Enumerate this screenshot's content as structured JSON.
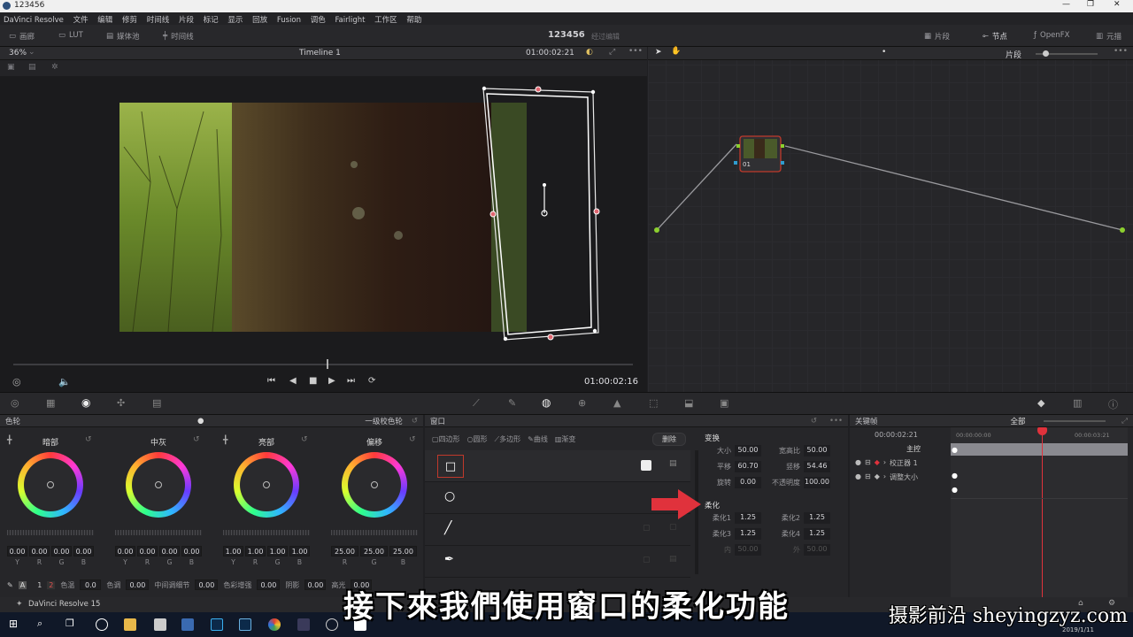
{
  "window": {
    "title": "123456"
  },
  "menu": [
    "DaVinci Resolve",
    "文件",
    "编辑",
    "修剪",
    "时间线",
    "片段",
    "标记",
    "显示",
    "回放",
    "Fusion",
    "调色",
    "Fairlight",
    "工作区",
    "帮助"
  ],
  "toolbar": {
    "left": [
      "画廊",
      "LUT",
      "媒体池",
      "时间线"
    ],
    "project": "123456",
    "status": "经过编辑",
    "right": [
      "片段",
      "节点",
      "OpenFX",
      "元描"
    ]
  },
  "viewer": {
    "zoom": "36%",
    "timeline": "Timeline 1",
    "timecode_top": "01:00:02:21",
    "timecode_bottom": "01:00:02:16"
  },
  "nodes": {
    "clip_dropdown": "片段",
    "node_label": "01"
  },
  "color_wheels": {
    "title": "色轮",
    "mode": "一级校色轮",
    "wheels": [
      {
        "name": "暗部",
        "values": [
          "0.00",
          "0.00",
          "0.00",
          "0.00"
        ],
        "channels": [
          "Y",
          "R",
          "G",
          "B"
        ]
      },
      {
        "name": "中灰",
        "values": [
          "0.00",
          "0.00",
          "0.00",
          "0.00"
        ],
        "channels": [
          "Y",
          "R",
          "G",
          "B"
        ]
      },
      {
        "name": "亮部",
        "values": [
          "1.00",
          "1.00",
          "1.00",
          "1.00"
        ],
        "channels": [
          "Y",
          "R",
          "G",
          "B"
        ]
      },
      {
        "name": "偏移",
        "values": [
          "25.00",
          "25.00",
          "25.00"
        ],
        "channels": [
          "R",
          "G",
          "B"
        ]
      }
    ],
    "bottom": {
      "page1": "1",
      "page2": "2",
      "items": [
        {
          "label": "色温",
          "value": "0.0"
        },
        {
          "label": "色调",
          "value": "0.00"
        },
        {
          "label": "中间调细节",
          "value": "0.00"
        },
        {
          "label": "色彩增强",
          "value": "0.00"
        },
        {
          "label": "阴影",
          "value": "0.00"
        },
        {
          "label": "高光",
          "value": "0.00"
        }
      ]
    }
  },
  "window_panel": {
    "title": "窗口",
    "tools": [
      "四边形",
      "圆形",
      "多边形",
      "曲线",
      "渐变"
    ],
    "delete": "删除",
    "transform": {
      "title": "变换",
      "fields": [
        {
          "label": "大小",
          "value": "50.00"
        },
        {
          "label": "宽高比",
          "value": "50.00"
        },
        {
          "label": "平移",
          "value": "60.70"
        },
        {
          "label": "竖移",
          "value": "54.46"
        },
        {
          "label": "旋转",
          "value": "0.00"
        },
        {
          "label": "不透明度",
          "value": "100.00"
        }
      ]
    },
    "softness": {
      "title": "柔化",
      "fields": [
        {
          "label": "柔化1",
          "value": "1.25"
        },
        {
          "label": "柔化2",
          "value": "1.25"
        },
        {
          "label": "柔化3",
          "value": "1.25"
        },
        {
          "label": "柔化4",
          "value": "1.25"
        },
        {
          "label": "内",
          "value": "50.00"
        },
        {
          "label": "外",
          "value": "50.00"
        }
      ]
    }
  },
  "keyframes": {
    "title": "关键帧",
    "filter": "全部",
    "timecode": "00:00:02:21",
    "ruler": [
      "00:00:00:00",
      "00:00:03:21"
    ],
    "tracks": [
      "主控",
      "校正器 1",
      "调整大小"
    ]
  },
  "statusbar": {
    "app": "DaVinci Resolve 15"
  },
  "subtitle": "接下來我們使用窗口的柔化功能",
  "watermark": "摄影前沿 sheyingzyz.com",
  "taskbar": {
    "date": "2019/1/11"
  },
  "colors": {
    "accent_red": "#e0323c",
    "node_border": "#c0392b",
    "wheel_bg": "#2a2a2d"
  }
}
